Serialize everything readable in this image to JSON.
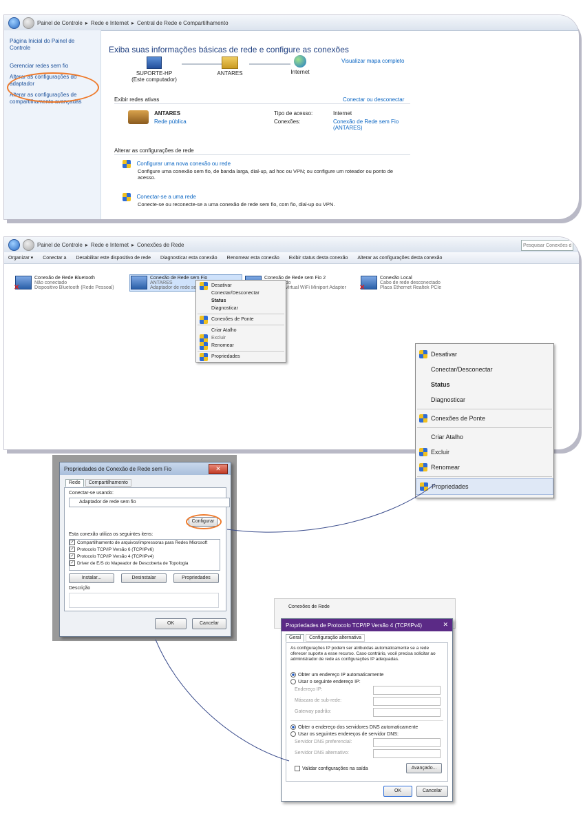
{
  "panel1": {
    "breadcrumb": [
      "Painel de Controle",
      "Rede e Internet",
      "Central de Rede e Compartilhamento"
    ],
    "sidebar": [
      "Página Inicial do Painel de Controle",
      "Gerenciar redes sem fio",
      "Alterar as configurações do adaptador",
      "Alterar as configurações de compartilhamento avançadas"
    ],
    "heading": "Exiba suas informações básicas de rede e configure as conexões",
    "full_map_link": "Visualizar mapa completo",
    "nodes": [
      {
        "name": "SUPORTE-HP",
        "sub": "(Este computador)"
      },
      {
        "name": "ANTARES",
        "sub": ""
      },
      {
        "name": "Internet",
        "sub": ""
      }
    ],
    "active_networks_label": "Exibir redes ativas",
    "connect_disconnect_link": "Conectar ou desconectar",
    "network_name": "ANTARES",
    "network_type": "Rede pública",
    "access_type_label": "Tipo de acesso:",
    "access_type_value": "Internet",
    "connections_label": "Conexões:",
    "connection_value": "Conexão de Rede sem Fio (ANTARES)",
    "change_settings_label": "Alterar as configurações de rede",
    "tasks": [
      {
        "title": "Configurar uma nova conexão ou rede",
        "desc": "Configure uma conexão sem fio, de banda larga, dial-up, ad hoc ou VPN; ou configure um roteador ou ponto de acesso."
      },
      {
        "title": "Conectar-se a uma rede",
        "desc": "Conecte-se ou reconecte-se a uma conexão de rede sem fio, com fio, dial-up ou VPN."
      }
    ]
  },
  "panel2": {
    "breadcrumb": [
      "Painel de Controle",
      "Rede e Internet",
      "Conexões de Rede"
    ],
    "search_placeholder": "Pesquisar Conexões de Rede",
    "toolbar": [
      "Organizar ▾",
      "Conectar a",
      "Desabilitar este dispositivo de rede",
      "Diagnosticar esta conexão",
      "Renomear esta conexão",
      "Exibir status desta conexão",
      "Alterar as configurações desta conexão"
    ],
    "connections": [
      {
        "name": "Conexão de Rede Bluetooth",
        "l2": "Não conectado",
        "l3": "Dispositivo Bluetooth (Rede Pessoal)",
        "disabled": true
      },
      {
        "name": "Conexão de Rede sem Fio",
        "l2": "ANTARES",
        "l3": "Adaptador de rede sem fio",
        "disabled": false
      },
      {
        "name": "Conexão de Rede sem Fio 2",
        "l2": "Desabilitado",
        "l3": "Microsoft Virtual WiFi Miniport Adapter",
        "disabled": false
      },
      {
        "name": "Conexão Local",
        "l2": "Cabo de rede desconectado",
        "l3": "Placa Ethernet Realtek PCIe",
        "disabled": true
      }
    ],
    "context_menu_small": [
      "Desativar",
      "Conectar/Desconectar",
      "Status",
      "Diagnosticar",
      "Conexões de Ponte",
      "Criar Atalho",
      "Excluir",
      "Renomear",
      "Propriedades"
    ]
  },
  "context_menu": {
    "items": [
      {
        "label": "Desativar",
        "shield": true,
        "bold": false
      },
      {
        "label": "Conectar/Desconectar",
        "shield": false,
        "bold": false
      },
      {
        "label": "Status",
        "shield": false,
        "bold": true
      },
      {
        "label": "Diagnosticar",
        "shield": false,
        "bold": false
      },
      {
        "label": "Conexões de Ponte",
        "shield": true,
        "bold": false
      },
      {
        "label": "Criar Atalho",
        "shield": false,
        "bold": false
      },
      {
        "label": "Excluir",
        "shield": true,
        "bold": false
      },
      {
        "label": "Renomear",
        "shield": true,
        "bold": false
      },
      {
        "label": "Propriedades",
        "shield": true,
        "bold": false
      }
    ]
  },
  "dialog1": {
    "title": "Propriedades de Conexão de Rede sem Fio",
    "tabs": [
      "Rede",
      "Compartilhamento"
    ],
    "connect_using_label": "Conectar-se usando:",
    "adapter": "Adaptador de rede sem fio",
    "configure_button": "Configurar",
    "items_label": "Esta conexão utiliza os seguintes itens:",
    "items": [
      "Compartilhamento de arquivos/impressoras para Redes Microsoft",
      "Protocolo TCP/IP Versão 6 (TCP/IPv6)",
      "Protocolo TCP/IP Versão 4 (TCP/IPv4)",
      "Driver de E/S do Mapeador de Descoberta de Topologia"
    ],
    "install_button": "Instalar...",
    "uninstall_button": "Desinstalar",
    "properties_button": "Propriedades",
    "description_label": "Descrição",
    "ok_button": "OK",
    "cancel_button": "Cancelar"
  },
  "dialog2": {
    "bg_title": "Conexões de Rede",
    "title": "Propriedades de Protocolo TCP/IP Versão 4 (TCP/IPv4)",
    "tabs": [
      "Geral",
      "Configuração alternativa"
    ],
    "intro": "As configurações IP podem ser atribuídas automaticamente se a rede oferecer suporte a esse recurso. Caso contrário, você precisa solicitar ao administrador de rede as configurações IP adequadas.",
    "ip_auto": "Obter um endereço IP automaticamente",
    "ip_manual": "Usar o seguinte endereço IP:",
    "ip_fields": [
      "Endereço IP:",
      "Máscara de sub-rede:",
      "Gateway padrão:"
    ],
    "dns_auto": "Obter o endereço dos servidores DNS automaticamente",
    "dns_manual": "Usar os seguintes endereços de servidor DNS:",
    "dns_fields": [
      "Servidor DNS preferencial:",
      "Servidor DNS alternativo:"
    ],
    "validate": "Validar configurações na saída",
    "advanced_button": "Avançado...",
    "ok_button": "OK",
    "cancel_button": "Cancelar"
  },
  "colors": {
    "highlight_circle": "#ee7a2b",
    "connector_line": "#3a4c8c",
    "dialog2_title": "#5b2a86"
  }
}
